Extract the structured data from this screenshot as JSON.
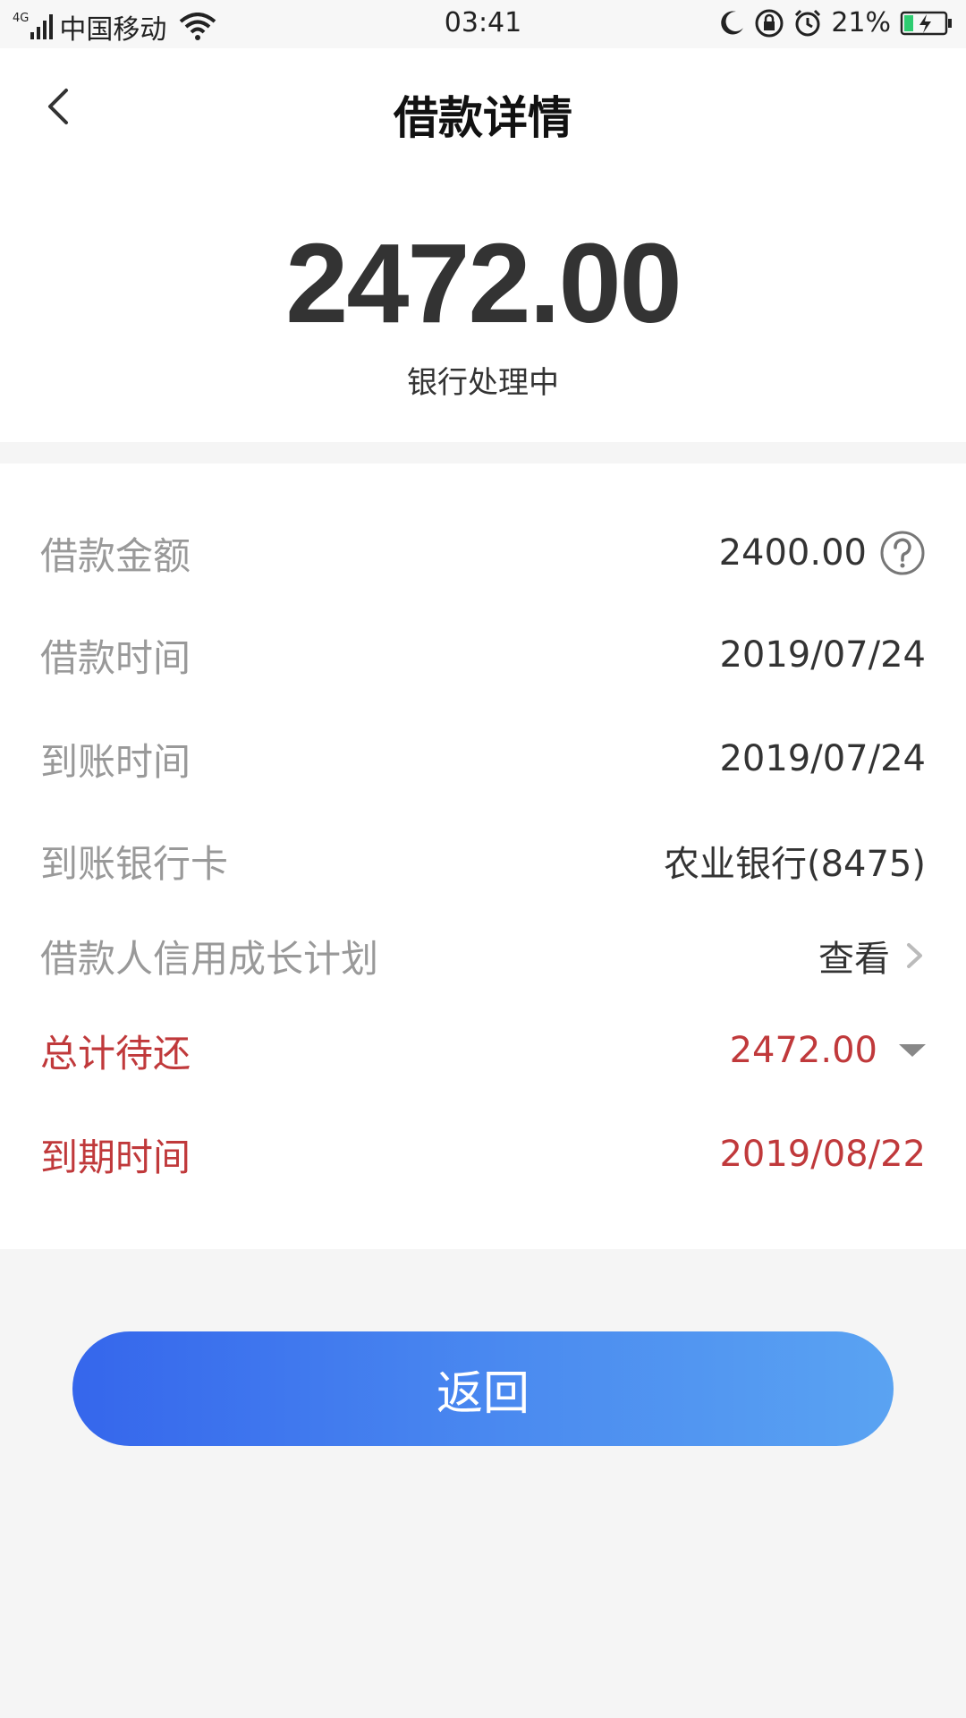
{
  "status_bar": {
    "network": "4G",
    "carrier": "中国移动",
    "time": "03:41",
    "battery": "21%"
  },
  "header": {
    "back_icon": "chevron-left-icon",
    "title": "借款详情",
    "amount": "2472.00",
    "status": "银行处理中"
  },
  "details": [
    {
      "label": "借款金额",
      "value": "2400.00"
    },
    {
      "label": "借款时间",
      "value": "2019/07/24"
    },
    {
      "label": "到账时间",
      "value": "2019/07/24"
    },
    {
      "label": "到账银行卡",
      "value": "农业银行(8475)"
    },
    {
      "label": "借款人信用成长计划",
      "value": "查看"
    },
    {
      "label": "总计待还",
      "value": "2472.00"
    },
    {
      "label": "到期时间",
      "value": "2019/08/22"
    }
  ],
  "return_button": "返回",
  "colors": {
    "accent_red": "#c0393b",
    "button_gradient_start": "#3566ec",
    "button_gradient_end": "#5aa3f2",
    "battery_green": "#2ecc71"
  }
}
